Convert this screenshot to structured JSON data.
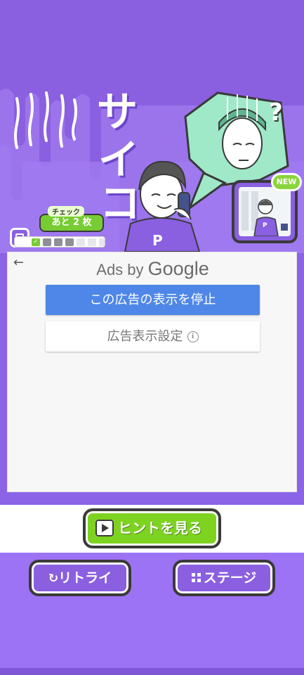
{
  "game": {
    "title_chars": [
      "サ",
      "イ",
      "コ"
    ],
    "question_mark": "?",
    "shirt_letter": "P",
    "thumb_shirt_letter": "P"
  },
  "check_counter": {
    "title": "チェック",
    "remaining_text": "あと 2 枚",
    "cards": [
      "checked",
      "gray",
      "gray",
      "gray",
      "empty",
      "empty",
      "empty"
    ]
  },
  "new_badge": "NEW",
  "ad": {
    "back_icon": "back-arrow-icon",
    "ads_by": "Ads by",
    "google": "Google",
    "stop_button": "この広告の表示を停止",
    "settings_button": "広告表示設定",
    "info_icon": "i"
  },
  "buttons": {
    "hint": "ヒントを見る",
    "retry": "リトライ",
    "retry_icon": "↻",
    "stage": "ステージ"
  },
  "colors": {
    "brand_purple": "#8a5fe0",
    "hint_green": "#7ed321",
    "ad_blue": "#4f87e8"
  }
}
